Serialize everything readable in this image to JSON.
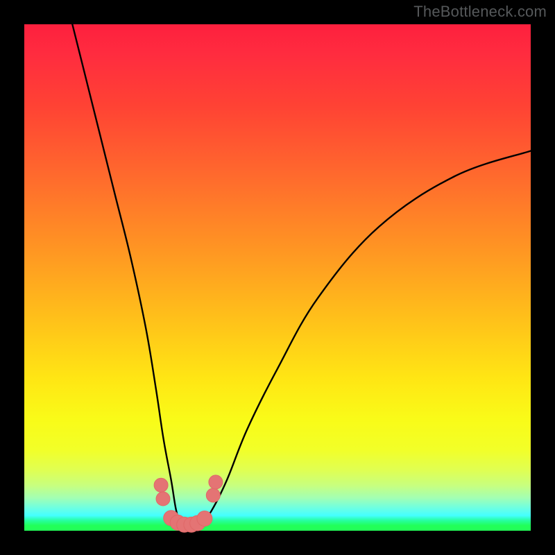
{
  "watermark": "TheBottleneck.com",
  "colors": {
    "page_bg": "#000000",
    "curve_stroke": "#000000",
    "marker_fill": "#e47474",
    "marker_stroke": "#e06868",
    "gradient_top": "#fe203e",
    "gradient_bottom": "#22ff58"
  },
  "chart_data": {
    "type": "line",
    "title": "",
    "xlabel": "",
    "ylabel": "",
    "xlim": [
      0,
      100
    ],
    "ylim": [
      0,
      100
    ],
    "grid": false,
    "legend": false,
    "curve": {
      "comment": "V-shaped bottleneck curve; y is percent of plot height from bottom, x is percent of plot width from left",
      "x": [
        9.5,
        12,
        15,
        18,
        21,
        24,
        26,
        27.5,
        29,
        30,
        31,
        33,
        35,
        37,
        40,
        44,
        50,
        58,
        70,
        85,
        100
      ],
      "y": [
        100,
        90,
        78,
        66,
        54,
        40,
        28,
        18,
        10,
        4,
        1.5,
        1.2,
        1.5,
        4,
        10,
        20,
        32,
        46,
        60,
        70,
        75
      ]
    },
    "markers": {
      "comment": "Salmon-pink dots clustered near the valley/min of the curve",
      "points": [
        {
          "x": 27.0,
          "y": 9.0,
          "r": 10
        },
        {
          "x": 27.4,
          "y": 6.3,
          "r": 10
        },
        {
          "x": 29.0,
          "y": 2.5,
          "r": 11
        },
        {
          "x": 30.3,
          "y": 1.6,
          "r": 11
        },
        {
          "x": 31.6,
          "y": 1.2,
          "r": 11
        },
        {
          "x": 33.0,
          "y": 1.2,
          "r": 11
        },
        {
          "x": 34.2,
          "y": 1.5,
          "r": 11
        },
        {
          "x": 35.6,
          "y": 2.4,
          "r": 11
        },
        {
          "x": 37.3,
          "y": 7.0,
          "r": 10
        },
        {
          "x": 37.8,
          "y": 9.6,
          "r": 10
        }
      ]
    }
  }
}
